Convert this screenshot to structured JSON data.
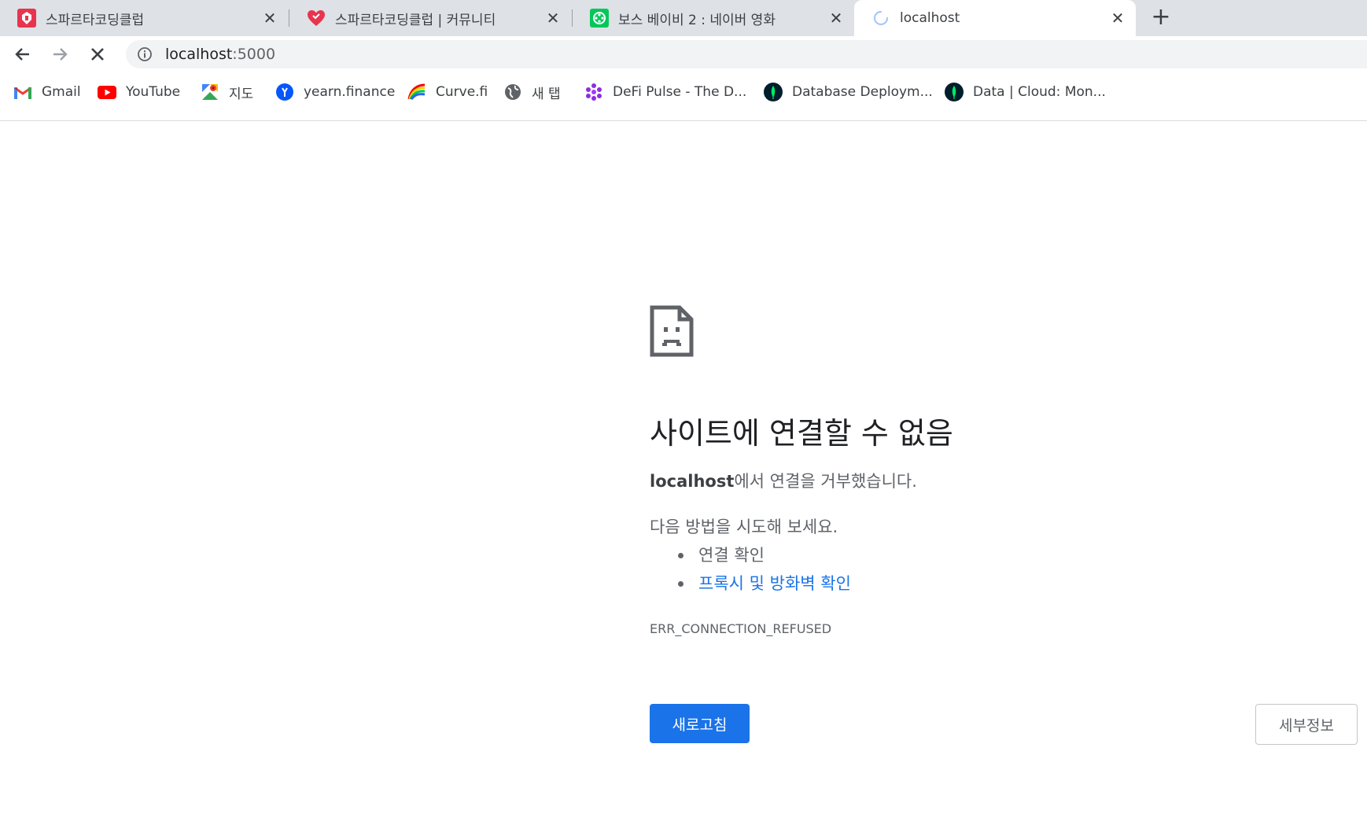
{
  "tabs": [
    {
      "title": "스파르타코딩클럽",
      "favicon": "sparta-helmet-icon",
      "close": "✕",
      "color": "#e8344e"
    },
    {
      "title": "스파르타코딩클럽 | 커뮤니티",
      "favicon": "heart-chat-icon",
      "close": "✕",
      "color": "#e8344e"
    },
    {
      "title": "보스 베이비 2 : 네이버 영화",
      "favicon": "naver-movie-icon",
      "close": "✕",
      "color": "#03c75a"
    },
    {
      "title": "localhost",
      "favicon": "loading-spinner-icon",
      "close": "✕",
      "active": true
    }
  ],
  "new_tab": "+",
  "toolbar": {
    "url_host": "localhost",
    "url_port": ":5000"
  },
  "bookmarks": [
    {
      "label": "Gmail",
      "icon": "gmail-icon"
    },
    {
      "label": "YouTube",
      "icon": "youtube-icon"
    },
    {
      "label": "지도",
      "icon": "maps-icon"
    },
    {
      "label": "yearn.finance",
      "icon": "yearn-icon"
    },
    {
      "label": "Curve.fi",
      "icon": "curve-icon"
    },
    {
      "label": "새 탭",
      "icon": "globe-icon"
    },
    {
      "label": "DeFi Pulse - The D...",
      "icon": "defi-pulse-icon"
    },
    {
      "label": "Database Deploym...",
      "icon": "mongodb-leaf-icon"
    },
    {
      "label": "Data | Cloud: Mon...",
      "icon": "mongodb-leaf-icon"
    }
  ],
  "error": {
    "title": "사이트에 연결할 수 없음",
    "host": "localhost",
    "message_suffix": "에서 연결을 거부했습니다.",
    "suggest": "다음 방법을 시도해 보세요.",
    "items": [
      "연결 확인",
      "프록시 및 방화벽 확인"
    ],
    "code": "ERR_CONNECTION_REFUSED",
    "reload": "새로고침",
    "details": "세부정보"
  },
  "colors": {
    "accent": "#1a73e8",
    "tabstrip": "#dee1e6",
    "text_secondary": "#5f6368"
  }
}
